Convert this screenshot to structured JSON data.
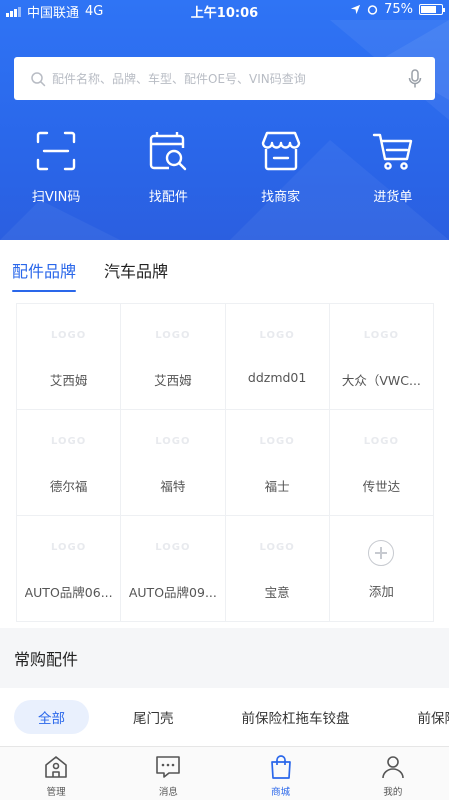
{
  "status_bar": {
    "carrier": "中国联通",
    "network": "4G",
    "time": "上午10:06",
    "battery": "75%",
    "battery_level": 0.75
  },
  "search": {
    "placeholder": "配件名称、品牌、车型、配件OE号、VIN码查询",
    "value": ""
  },
  "quick_actions": [
    {
      "label": "扫VIN码",
      "icon": "scan-icon"
    },
    {
      "label": "找配件",
      "icon": "parts-search-icon"
    },
    {
      "label": "找商家",
      "icon": "store-icon"
    },
    {
      "label": "进货单",
      "icon": "cart-icon"
    }
  ],
  "brand_tabs": [
    {
      "label": "配件品牌",
      "active": true
    },
    {
      "label": "汽车品牌",
      "active": false
    }
  ],
  "brands": [
    {
      "name": "艾西姆",
      "logo": "LOGO"
    },
    {
      "name": "艾西姆",
      "logo": "LOGO"
    },
    {
      "name": "ddzmd01",
      "logo": "LOGO"
    },
    {
      "name": "大众（VWC...",
      "logo": "LOGO"
    },
    {
      "name": "德尔福",
      "logo": "LOGO"
    },
    {
      "name": "福特",
      "logo": "LOGO"
    },
    {
      "name": "福士",
      "logo": "LOGO"
    },
    {
      "name": "传世达",
      "logo": "LOGO"
    },
    {
      "name": "AUTO品牌06...",
      "logo": "LOGO"
    },
    {
      "name": "AUTO品牌09...",
      "logo": "LOGO"
    },
    {
      "name": "宝意",
      "logo": "LOGO"
    }
  ],
  "add_brand_label": "添加",
  "frequent_parts": {
    "title": "常购配件",
    "chips": [
      "全部",
      "尾门壳",
      "前保险杠拖车铰盘",
      "前保险"
    ]
  },
  "tab_bar": [
    {
      "label": "管理",
      "icon": "home-icon",
      "active": false
    },
    {
      "label": "消息",
      "icon": "message-icon",
      "active": false
    },
    {
      "label": "商城",
      "icon": "shopping-bag-icon",
      "active": true
    },
    {
      "label": "我的",
      "icon": "user-icon",
      "active": false
    }
  ],
  "colors": {
    "primary": "#2a67ea",
    "header_top": "#2f74f5",
    "chip_active_bg": "#e9f0fd"
  }
}
